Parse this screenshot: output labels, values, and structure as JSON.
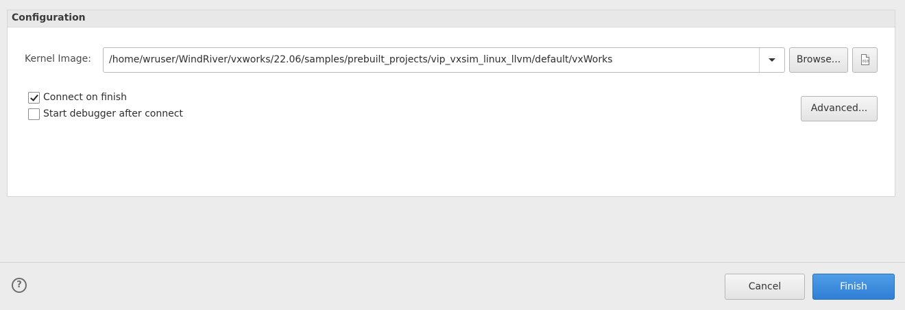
{
  "configuration": {
    "title": "Configuration",
    "kernel_image": {
      "label": "Kernel Image:",
      "value": "/home/wruser/WindRiver/vxworks/22.06/samples/prebuilt_projects/vip_vxsim_linux_llvm/default/vxWorks"
    },
    "browse_label": "Browse...",
    "file_icon_text": "010",
    "advanced_label": "Advanced...",
    "options": [
      {
        "label": "Connect on finish",
        "checked": true
      },
      {
        "label": "Start debugger after connect",
        "checked": false
      }
    ]
  },
  "footer": {
    "help_symbol": "?",
    "cancel_label": "Cancel",
    "finish_label": "Finish"
  },
  "colors": {
    "primary_button": "#2f7fd6",
    "background": "#ececec"
  }
}
